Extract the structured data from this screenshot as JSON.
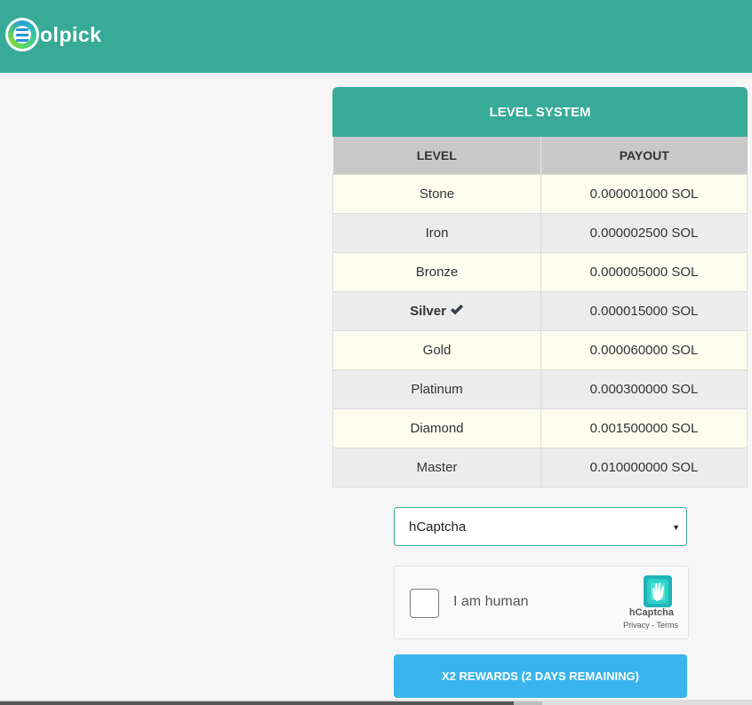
{
  "header": {
    "logo_text": "olpick",
    "brand_color": "#38ab98"
  },
  "level_system": {
    "title": "LEVEL SYSTEM",
    "columns": [
      "LEVEL",
      "PAYOUT"
    ],
    "rows": [
      {
        "level": "Stone",
        "payout": "0.000001000 SOL",
        "current": false
      },
      {
        "level": "Iron",
        "payout": "0.000002500 SOL",
        "current": false
      },
      {
        "level": "Bronze",
        "payout": "0.000005000 SOL",
        "current": false
      },
      {
        "level": "Silver",
        "payout": "0.000015000 SOL",
        "current": true
      },
      {
        "level": "Gold",
        "payout": "0.000060000 SOL",
        "current": false
      },
      {
        "level": "Platinum",
        "payout": "0.000300000 SOL",
        "current": false
      },
      {
        "level": "Diamond",
        "payout": "0.001500000 SOL",
        "current": false
      },
      {
        "level": "Master",
        "payout": "0.010000000 SOL",
        "current": false
      }
    ]
  },
  "captcha_select": {
    "selected": "hCaptcha"
  },
  "captcha_widget": {
    "label": "I am human",
    "brand": "hCaptcha",
    "links": "Privacy - Terms"
  },
  "reward_button": {
    "label": "X2 REWARDS (2 DAYS REMAINING)",
    "color": "#3ab4ec"
  }
}
